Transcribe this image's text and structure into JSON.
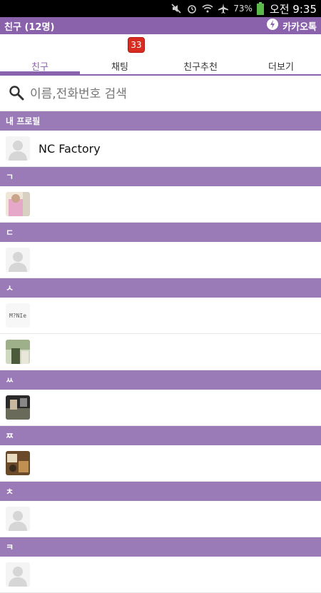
{
  "statusbar": {
    "battery": "73%",
    "time": "오전 9:35"
  },
  "appbar": {
    "title": "친구 (12명)",
    "brand": "카카오톡"
  },
  "tabs": [
    {
      "label": "친구",
      "active": true
    },
    {
      "label": "채팅",
      "active": false
    },
    {
      "label": "친구추천",
      "active": false
    },
    {
      "label": "더보기",
      "active": false
    }
  ],
  "chat_badge": "33",
  "search": {
    "placeholder": "이름,전화번호 검색"
  },
  "sections": {
    "profile": "내 프로필",
    "g": "ㄱ",
    "d": "ㄷ",
    "s": "ㅅ",
    "ss": "ㅆ",
    "jj": "ㅉ",
    "ch": "ㅊ",
    "k": "ㅋ"
  },
  "profile_name": "NC Factory",
  "avatar_text_minie": "M?NIe"
}
